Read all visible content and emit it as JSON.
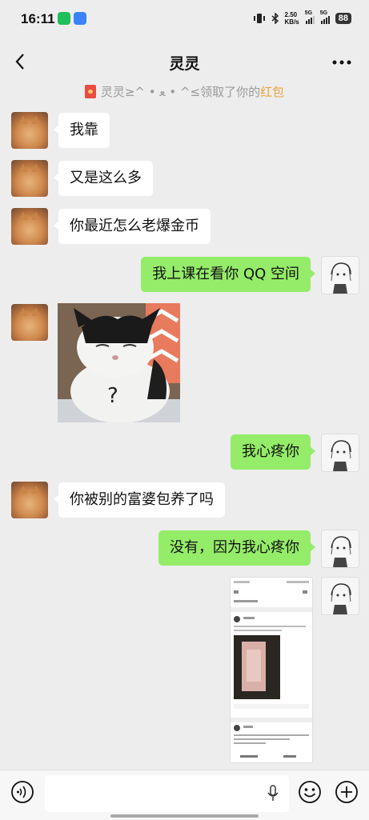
{
  "status": {
    "time": "16:11",
    "net_speed_value": "2.50",
    "net_speed_unit": "KB/s",
    "sim1": "5G",
    "sim2": "5G",
    "battery": "88"
  },
  "chat": {
    "title": "灵灵"
  },
  "notice": {
    "prefix": "灵灵≥^ • ﻌ • ^≤领取了你的",
    "highlight": "红包"
  },
  "messages": [
    {
      "from": "them",
      "text": "我靠"
    },
    {
      "from": "them",
      "text": "又是这么多"
    },
    {
      "from": "them",
      "text": "你最近怎么老爆金币"
    },
    {
      "from": "me",
      "text": "我上课在看你 QQ 空间"
    },
    {
      "from": "them",
      "text": "?"
    },
    {
      "from": "me",
      "text": "我心疼你"
    },
    {
      "from": "them",
      "text": "你被别的富婆包养了吗"
    },
    {
      "from": "me",
      "text": "没有，因为我心疼你"
    }
  ],
  "icons": {
    "back": "back-arrow-icon",
    "more": "more-dots-icon",
    "voice": "voice-icon",
    "mic": "mic-icon",
    "emoji": "emoji-icon",
    "plus": "plus-icon",
    "red_packet": "red-packet-icon"
  },
  "colors": {
    "background": "#ededed",
    "out_bubble": "#95ec69",
    "in_bubble": "#ffffff",
    "highlight": "#e8a43a"
  }
}
